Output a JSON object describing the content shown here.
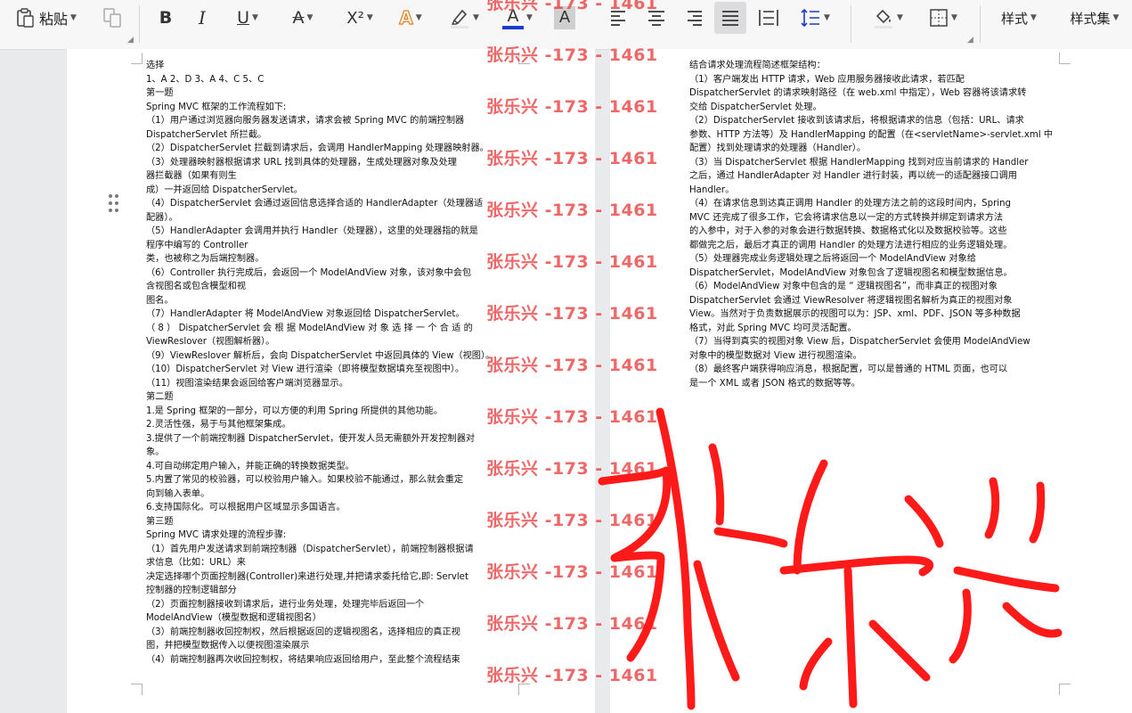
{
  "toolbar": {
    "paste_label": "粘贴",
    "bold_glyph": "B",
    "italic_glyph": "I",
    "underline_glyph": "U",
    "strike_glyph": "A",
    "superscript_glyph": "X²",
    "highlight_glyph": "A",
    "fontcolor_glyph": "A",
    "charshade_glyph": "A",
    "styles_label": "样式",
    "styleset_label": "样式集",
    "accent_red": "#e1372a",
    "accent_blue": "#1c39d0"
  },
  "watermark": {
    "text": "张乐兴 -173 - 1461",
    "color": "#ec3c3c"
  },
  "signature": {
    "text": "张乐兴",
    "color": "#ff1a1a"
  },
  "doc_left": {
    "lines": [
      "选择",
      "1、A 2、D 3、A 4、C 5、C",
      "第一题",
      "Spring MVC  框架的工作流程如下:",
      "（1）用户通过浏览器向服务器发送请求，请求会被  Spring MVC 的前端控制器",
      "DispatcherServlet  所拦截。",
      "（2）DispatcherServlet  拦截到请求后，会调用  HandlerMapping  处理器映射器。",
      "（3）处理器映射器根据请求  URL  找到具体的处理器，生成处理器对象及处理",
      "器拦截器（如果有则生",
      "成）一并返回给  DispatcherServlet。",
      "（4）DispatcherServlet  会通过返回信息选择合适的  HandlerAdapter（处理器适",
      "配器）。",
      "（5）HandlerAdapter  会调用并执行  Handler（处理器），这里的处理器指的就是",
      "程序中编写的  Controller",
      "类，也被称之为后端控制器。",
      "（6）Controller  执行完成后，会返回一个  ModelAndView  对象，该对象中会包",
      "含视图名或包含模型和视",
      "图名。",
      "（7）HandlerAdapter  将  ModelAndView  对象返回给  DispatcherServlet。",
      "（ 8 ）  DispatcherServlet   会 根 据    ModelAndView   对 象 选 择 一 个 合 适 的",
      "ViewReslover（视图解析器）。",
      "（9）ViewReslover  解析后，会向  DispatcherServlet  中返回具体的  View（视图）。",
      "（10）DispatcherServlet  对  View  进行渲染（即将模型数据填充至视图中）。",
      "（11）视图渲染结果会返回给客户端浏览器显示。",
      "第二题",
      "1.是  Spring  框架的一部分，可以方便的利用  Spring  所提供的其他功能。",
      "2.灵活性强，易于与其他框架集成。",
      "3.提供了一个前端控制器  DispatcherServlet，使开发人员无需额外开发控制器对",
      "象。",
      "4.可自动绑定用户输入，并能正确的转换数据类型。",
      "5.内置了常见的校验器，可以校验用户输入。如果校验不能通过，那么就会重定",
      "向到输入表单。",
      "6.支持国际化。可以根据用户区域显示多国语言。",
      "第三题",
      "Spring MVC  请求处理的流程步骤:",
      "（1）首先用户发送请求到前端控制器（DispatcherServlet），前端控制器根据请",
      "求信息（比如：URL）来",
      "决定选择哪个页面控制器(Controller)来进行处理,并把请求委托给它,即: Servlet",
      "控制器的控制逻辑部分",
      "（2）页面控制器接收到请求后，进行业务处理，处理完毕后返回一个",
      "ModelAndView（模型数据和逻辑视图名）",
      "（3）前端控制器收回控制权，然后根据返回的逻辑视图名，选择相应的真正视",
      "图，并把模型数据传入以便视图渲染展示",
      "（4）前端控制器再次收回控制权，将结果响应返回给用户，至此整个流程结束"
    ]
  },
  "doc_right": {
    "lines": [
      "结合请求处理流程简述框架结构：",
      "（1）客户端发出  HTTP  请求，Web  应用服务器接收此请求，若匹配",
      "DispatcherServlet 的请求映射路径（在  web.xml 中指定），Web 容器将该请求转",
      "交给  DispatcherServlet  处理。",
      "（2）DispatcherServlet  接收到该请求后，将根据请求的信息（包括：URL、请求",
      "参数、HTTP 方法等）及  HandlerMapping  的配置（在<servletName>-servlet.xml  中",
      "配置）找到处理请求的处理器（Handler）。",
      "（3）当  DispatcherServlet  根据  HandlerMapping  找到对应当前请求的  Handler",
      "之后，通过  HandlerAdapter 对  Handler  进行封装，再以统一的适配器接口调用",
      "Handler。",
      "（4）在请求信息到达真正调用  Handler  的处理方法之前的这段时间内，Spring",
      "MVC  还完成了很多工作，它会将请求信息以一定的方式转换并绑定到请求方法",
      "的入参中，对于入参的对象会进行数据转换、数据格式化以及数据校验等。这些",
      "都做完之后，最后才真正的调用  Handler  的处理方法进行相应的业务逻辑处理。",
      "（5）处理器完成业务逻辑处理之后将返回一个    ModelAndView  对象给",
      "DispatcherServlet，ModelAndView 对象包含了逻辑视图名和模型数据信息。",
      "（6）ModelAndView 对象中包含的是 “ 逻辑视图名”，而非真正的视图对象",
      "DispatcherServlet  会通过  ViewResolver  将逻辑视图名解析为真正的视图对象",
      "View。当然对于负责数据展示的视图可以为：JSP、xml、PDF、JSON 等多种数据",
      "格式，对此  Spring MVC  均可灵活配置。",
      "（7）当得到真实的视图对象  View  后，DispatcherServlet  会使用  ModelAndView",
      "对象中的模型数据对 View 进行视图渲染。",
      "（8）最终客户端获得响应消息，根据配置，可以是普通的  HTML  页面，也可以",
      "是一个  XML  或者  JSON 格式的数据等等。"
    ]
  }
}
